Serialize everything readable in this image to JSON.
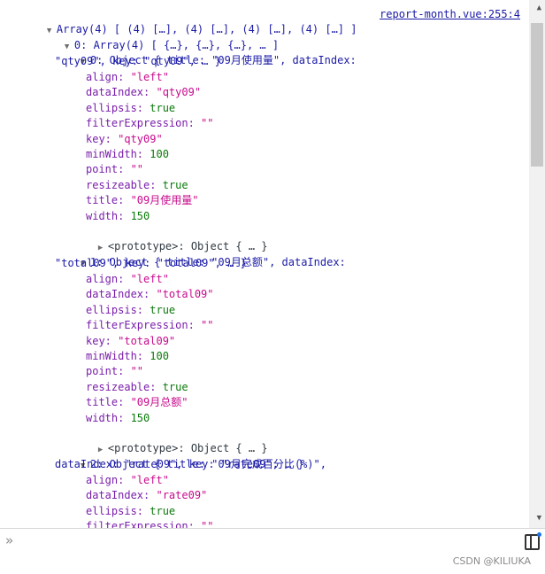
{
  "summary": {
    "text": "Array(4) [ (4) […], (4) […], (4) […], (4) […] ]"
  },
  "source_link": "report-month.vue:255:4",
  "row0": {
    "label": "0: Array(4) [ {…}, {…}, {…}, … ]"
  },
  "obj0": {
    "preview_line1": "0: Object { title: \"09月使用量\", dataIndex:",
    "preview_line2": "\"qty09\", key: \"qty09\", … }",
    "props": [
      {
        "k": "align: ",
        "v": "\"left\""
      },
      {
        "k": "dataIndex: ",
        "v": "\"qty09\""
      },
      {
        "k": "ellipsis: ",
        "v": "true"
      },
      {
        "k": "filterExpression: ",
        "v": "\"\""
      },
      {
        "k": "key: ",
        "v": "\"qty09\""
      },
      {
        "k": "minWidth: ",
        "v": "100"
      },
      {
        "k": "point: ",
        "v": "\"\""
      },
      {
        "k": "resizeable: ",
        "v": "true"
      },
      {
        "k": "title: ",
        "v": "\"09月使用量\""
      },
      {
        "k": "width: ",
        "v": "150"
      }
    ],
    "proto": "<prototype>: Object { … }"
  },
  "obj1": {
    "preview_line1": "1: Object { title: \"09月总额\", dataIndex:",
    "preview_line2": "\"total09\", key: \"total09\", … }",
    "props": [
      {
        "k": "align: ",
        "v": "\"left\""
      },
      {
        "k": "dataIndex: ",
        "v": "\"total09\""
      },
      {
        "k": "ellipsis: ",
        "v": "true"
      },
      {
        "k": "filterExpression: ",
        "v": "\"\""
      },
      {
        "k": "key: ",
        "v": "\"total09\""
      },
      {
        "k": "minWidth: ",
        "v": "100"
      },
      {
        "k": "point: ",
        "v": "\"\""
      },
      {
        "k": "resizeable: ",
        "v": "true"
      },
      {
        "k": "title: ",
        "v": "\"09月总额\""
      },
      {
        "k": "width: ",
        "v": "150"
      }
    ],
    "proto": "<prototype>: Object { … }"
  },
  "obj2": {
    "preview_line1": "2: Object { title: \"09月完成百分比(%)\",",
    "preview_line2": "dataIndex: \"rate09\", key: \"rate09\", … }",
    "props": [
      {
        "k": "align: ",
        "v": "\"left\""
      },
      {
        "k": "dataIndex: ",
        "v": "\"rate09\""
      },
      {
        "k": "ellipsis: ",
        "v": "true"
      },
      {
        "k": "filterExpression: ",
        "v": "\"\""
      }
    ]
  },
  "prompt_symbol": "»",
  "watermark": "CSDN @KILIUKA"
}
